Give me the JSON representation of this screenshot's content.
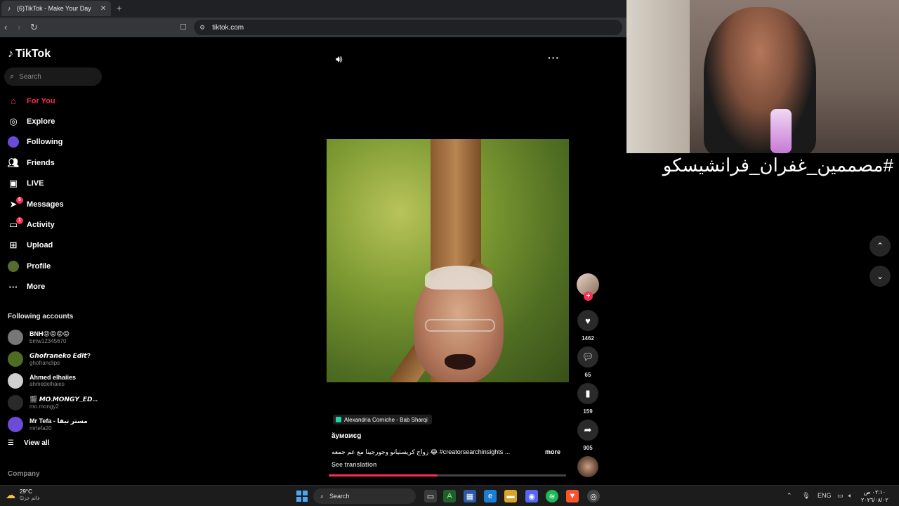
{
  "browser": {
    "tab_title": "(6)TikTok - Make Your Day",
    "close": "✕",
    "new_tab": "+",
    "url": "tiktok.com"
  },
  "sidebar": {
    "logo": "TikTok",
    "search_placeholder": "Search",
    "menu": [
      {
        "label": "For You",
        "icon": "home-icon",
        "active": true
      },
      {
        "label": "Explore",
        "icon": "compass-icon"
      },
      {
        "label": "Following",
        "icon": "avatar-icon"
      },
      {
        "label": "Friends",
        "icon": "friends-icon"
      },
      {
        "label": "LIVE",
        "icon": "live-icon"
      },
      {
        "label": "Messages",
        "icon": "paper-plane-icon",
        "badge": "5"
      },
      {
        "label": "Activity",
        "icon": "activity-icon",
        "badge": "1"
      },
      {
        "label": "Upload",
        "icon": "plus-square-icon"
      },
      {
        "label": "Profile",
        "icon": "profile-icon"
      },
      {
        "label": "More",
        "icon": "ellipsis-icon"
      }
    ],
    "following_title": "Following accounts",
    "accounts": [
      {
        "name": "BNH😝😝😝😝",
        "username": "bmw12345670"
      },
      {
        "name": "𝙂𝙝𝙤𝙛𝙧𝙖𝙣𝙚𝙠𝙤 𝙀𝙙𝙞𝙩?",
        "username": "ghofranclips"
      },
      {
        "name": "Ahmed elhaiies",
        "username": "ahmedelhaies"
      },
      {
        "name": "🎬 𝙈𝙊.𝙈𝙊𝙉𝙂𝙔_𝙀𝘿...",
        "username": "mo.mongy2"
      },
      {
        "name": "Mr Tefa - مستر تيفا",
        "username": "mrtefa20"
      }
    ],
    "view_all": "View all",
    "company": "Company"
  },
  "video": {
    "location": "Alexandria Corniche - Bab Sharqi",
    "author": "ăумαиєg",
    "caption": "زواج كريستيانو وجورجينا مع عم جمعه 😂 #creatorsearchinsights ...",
    "more": "more",
    "see_translation": "See translation",
    "progress": 0.46
  },
  "actions": {
    "likes": "1462",
    "comments": "65",
    "bookmarks": "159",
    "shares": "905"
  },
  "overlay": {
    "hashtag": "#مصممين_غفران_فرانشيسكو"
  },
  "taskbar": {
    "temp": "29°C",
    "weather_sub": "غائم جزئيًا",
    "search": "Search",
    "lang": "ENG",
    "time": "٠٢:١٠ ص",
    "date": "٢٠٢٦/٠٨/٠٢"
  },
  "colors": {
    "accent": "#fe2c55",
    "background": "#000000"
  }
}
